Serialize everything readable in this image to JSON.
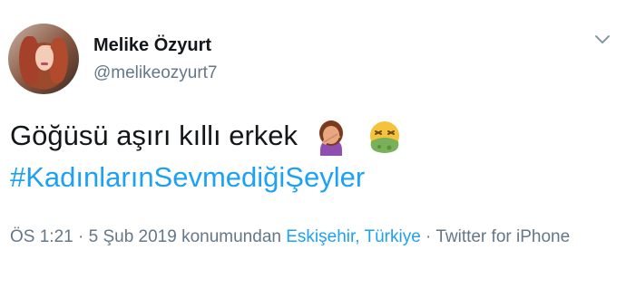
{
  "author": {
    "name": "Melike Özyurt",
    "handle": "@melikeozyurt7"
  },
  "tweet": {
    "text": "Göğüsü aşırı kıllı erkek",
    "emojis": [
      "woman-facepalming-icon",
      "nauseated-face-icon"
    ],
    "hashtag": "#KadınlarınSevmediğiŞeyler"
  },
  "meta": {
    "time": "ÖS 1:21",
    "sep1": " · ",
    "date": "5 Şub 2019",
    "location_prefix": " konumundan ",
    "location": "Eskişehir, Türkiye",
    "sep2": " · ",
    "client": "Twitter for iPhone"
  },
  "colors": {
    "link": "#1da1f2",
    "secondary": "#657786",
    "text": "#14171a"
  }
}
